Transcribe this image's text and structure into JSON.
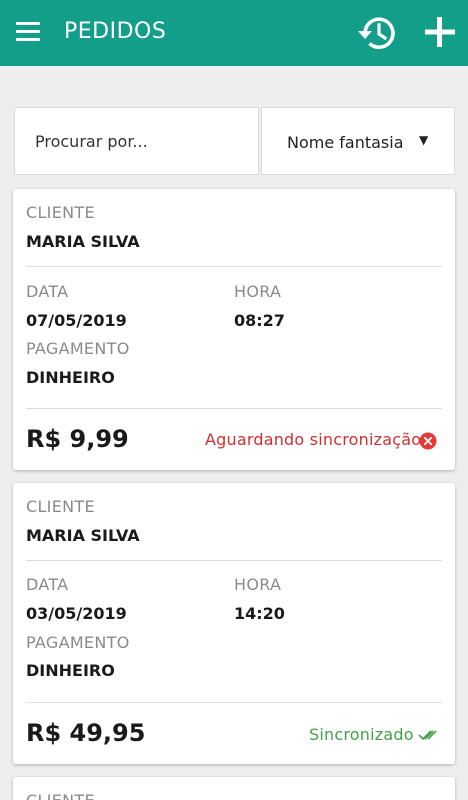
{
  "appbar": {
    "title": "PEDIDOS",
    "menu_icon": "menu-icon",
    "history_icon": "history-icon",
    "add_icon": "add-icon",
    "color": "#139e8a"
  },
  "search": {
    "placeholder": "Procurar por...",
    "filter_value": "Nome fantasia",
    "filter_caret": "▼"
  },
  "orders": [
    {
      "client_label": "CLIENTE",
      "client": "MARIA SILVA",
      "date_label": "DATA",
      "date": "07/05/2019",
      "time_label": "HORA",
      "time": "08:27",
      "payment_label": "PAGAMENTO",
      "payment": "DINHEIRO",
      "total": "R$ 9,99",
      "status": "Aguardando sincronização",
      "status_color": "#d32f2f",
      "status_icon": "error-icon"
    },
    {
      "client_label": "CLIENTE",
      "client": "MARIA SILVA",
      "date_label": "DATA",
      "date": "03/05/2019",
      "time_label": "HORA",
      "time": "14:20",
      "payment_label": "PAGAMENTO",
      "payment": "DINHEIRO",
      "total": "R$ 49,95",
      "status": "Sincronizado",
      "status_color": "#43a047",
      "status_icon": "double-check-icon"
    },
    {
      "client_label": "CLIENTE"
    }
  ]
}
